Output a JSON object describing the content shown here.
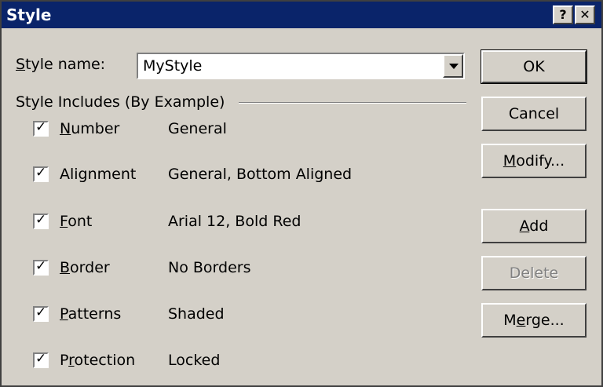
{
  "window": {
    "title": "Style",
    "help_glyph": "?",
    "close_glyph": "✕"
  },
  "style_name": {
    "label_prefix": "S",
    "label_rest": "tyle name:",
    "value": "MyStyle"
  },
  "group_label": "Style Includes (By Example)",
  "items": [
    {
      "mnemonic": "N",
      "rest": "umber",
      "checked": true,
      "value": "General"
    },
    {
      "mnemonic": "",
      "rest": "Alignment",
      "checked": true,
      "value": "General, Bottom Aligned"
    },
    {
      "mnemonic": "F",
      "rest": "ont",
      "checked": true,
      "value": "Arial 12, Bold Red"
    },
    {
      "mnemonic": "B",
      "rest": "order",
      "checked": true,
      "value": "No Borders"
    },
    {
      "mnemonic": "P",
      "rest": "atterns",
      "checked": true,
      "value": "Shaded"
    },
    {
      "pre": "P",
      "mnemonic": "r",
      "rest": "otection",
      "checked": true,
      "value": "Locked"
    }
  ],
  "buttons": {
    "ok": "OK",
    "cancel": "Cancel",
    "modify_m": "M",
    "modify_rest": "odify...",
    "add_a": "A",
    "add_rest": "dd",
    "delete": "Delete",
    "merge_pre": "M",
    "merge_e": "e",
    "merge_rest": "rge..."
  },
  "check_glyph": "✓"
}
